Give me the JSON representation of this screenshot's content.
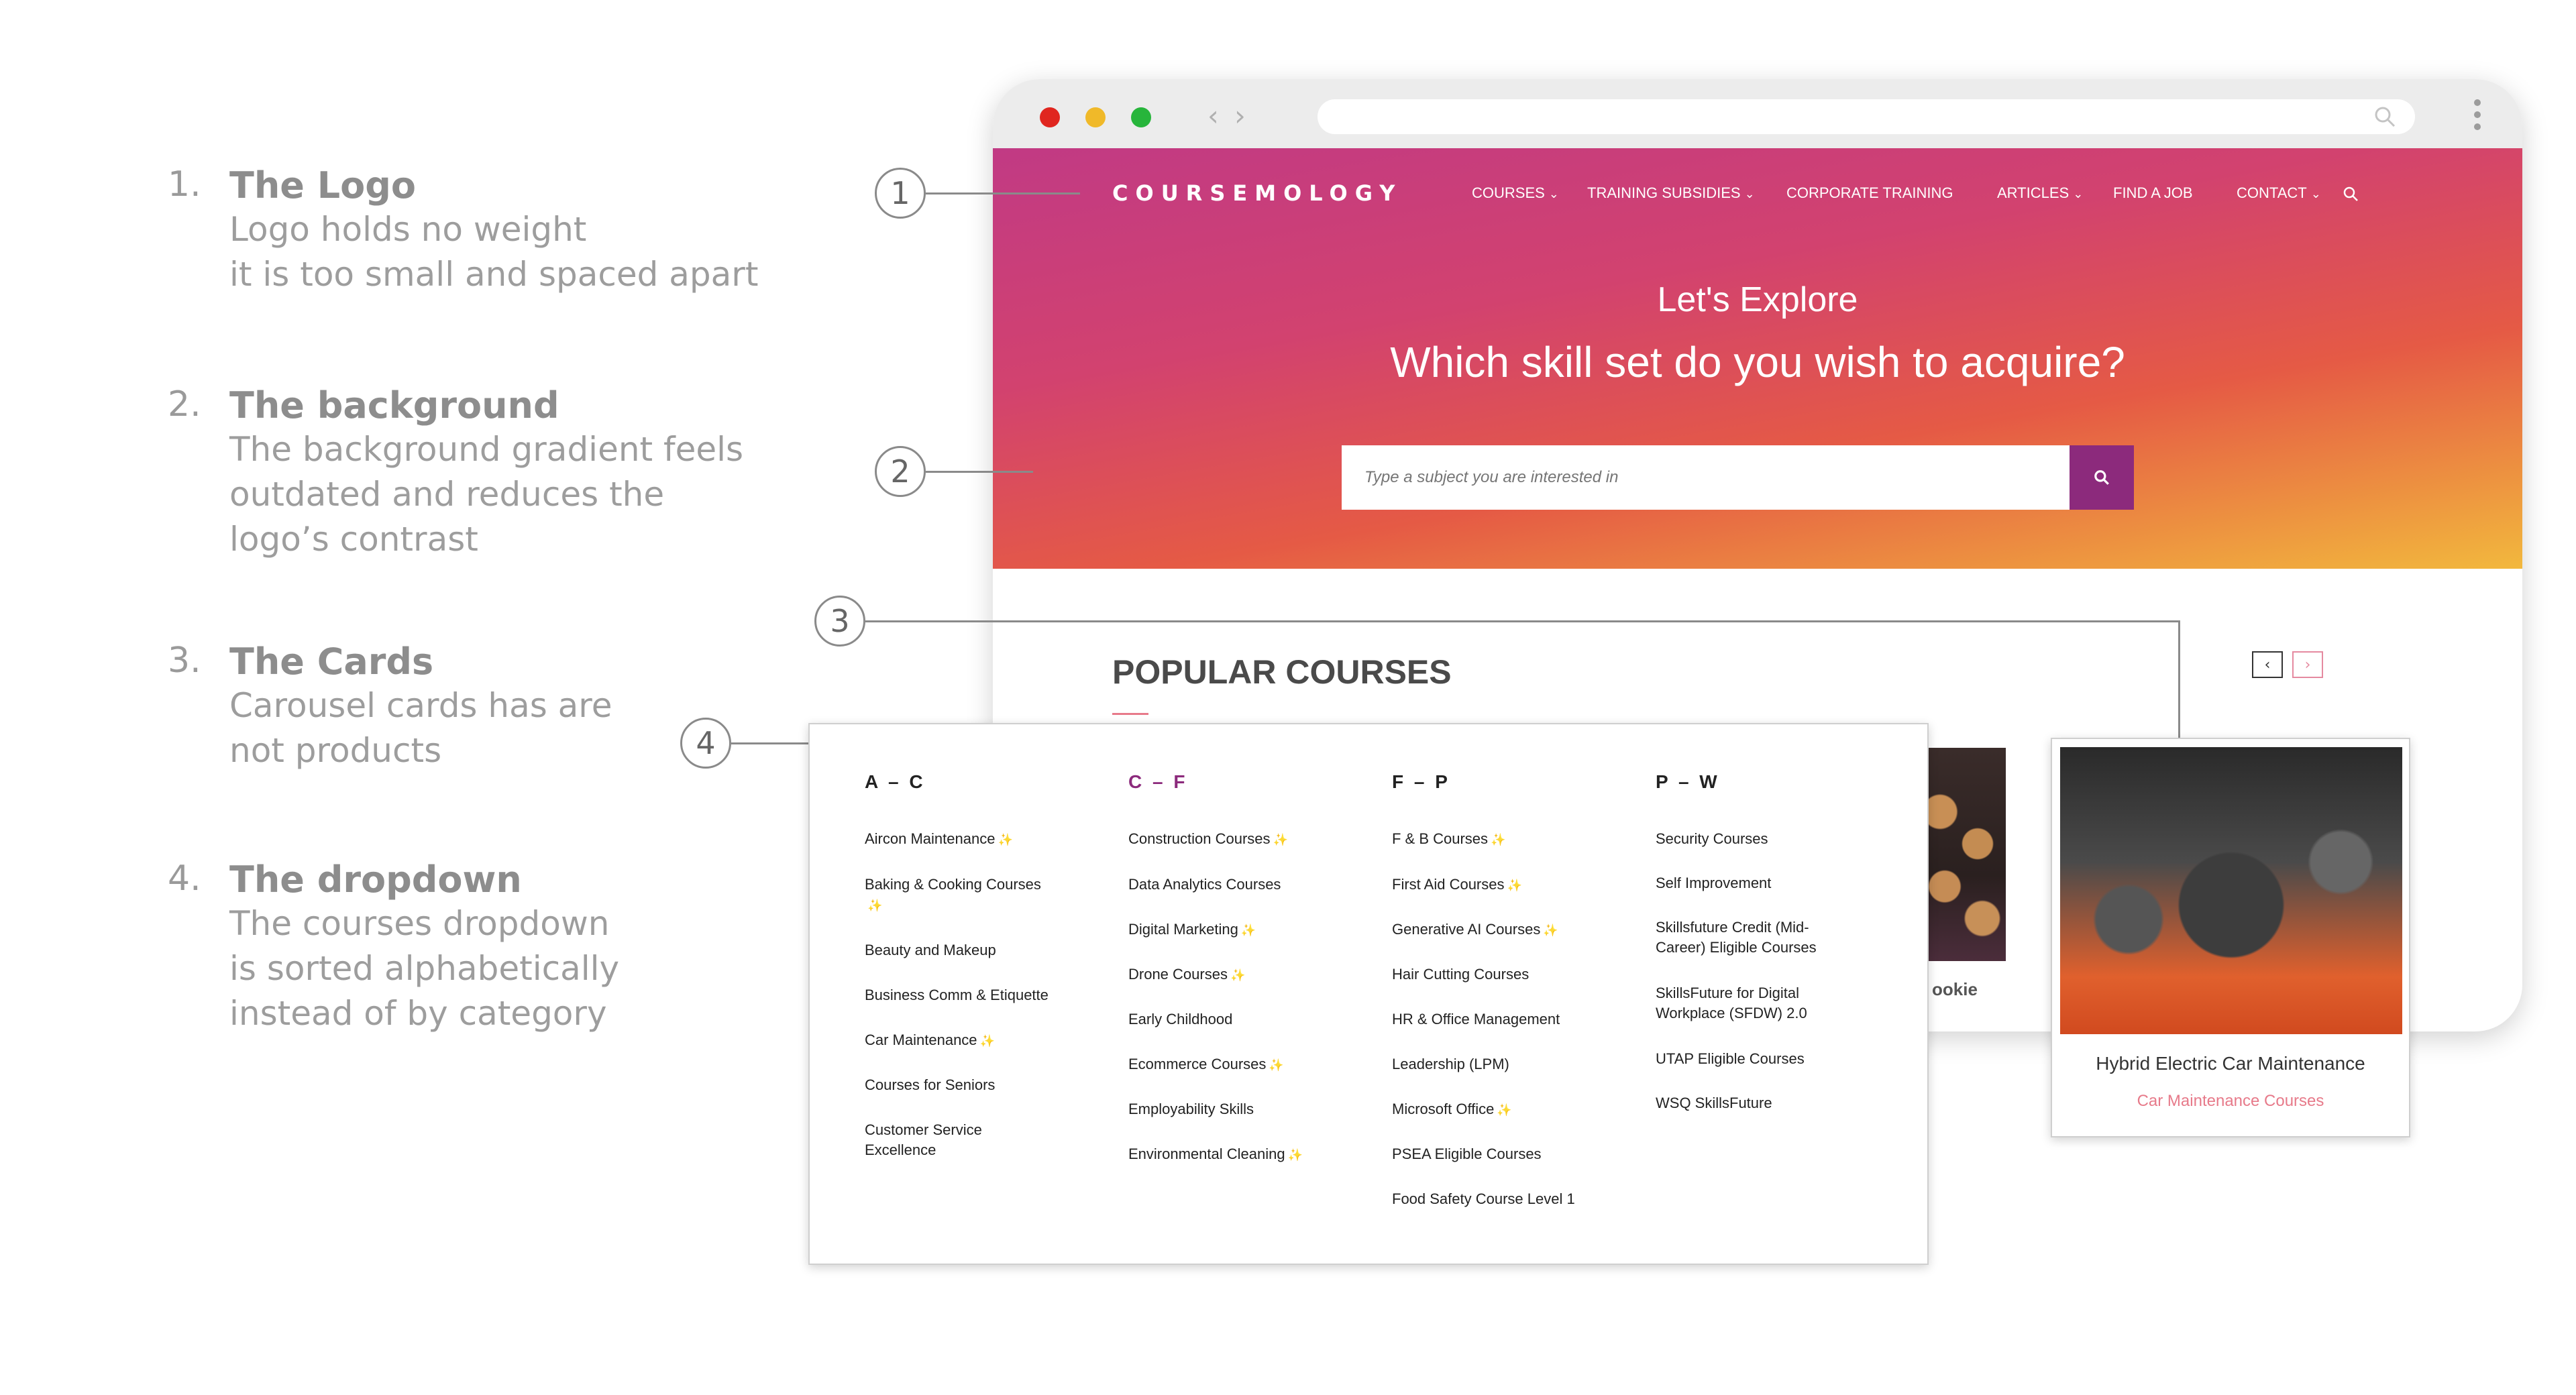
{
  "annotations": [
    {
      "num": "1.",
      "title": "The Logo",
      "lines": [
        "Logo holds no weight",
        "it is too small and spaced apart"
      ]
    },
    {
      "num": "2.",
      "title": "The background",
      "lines": [
        "The background gradient feels",
        "outdated and reduces the",
        "logo’s contrast"
      ]
    },
    {
      "num": "3.",
      "title": "The Cards",
      "lines": [
        "Carousel cards has are",
        "not products"
      ]
    },
    {
      "num": "4.",
      "title": "The dropdown",
      "lines": [
        "The courses dropdown",
        "is sorted alphabetically",
        "instead of by category"
      ]
    }
  ],
  "callouts": [
    "1",
    "2",
    "3",
    "4"
  ],
  "site": {
    "logo": "COURSEMOLOGY",
    "nav": [
      {
        "label": "COURSES",
        "dropdown": true
      },
      {
        "label": "TRAINING SUBSIDIES",
        "dropdown": true
      },
      {
        "label": "CORPORATE TRAINING",
        "dropdown": false
      },
      {
        "label": "ARTICLES",
        "dropdown": true
      },
      {
        "label": "FIND A JOB",
        "dropdown": false
      },
      {
        "label": "CONTACT",
        "dropdown": true
      }
    ],
    "hero_sub": "Let's Explore",
    "hero_title": "Which skill set do you wish to acquire?",
    "search_placeholder": "Type a subject you are interested in",
    "popular_title": "POPULAR COURSES",
    "carousel_prev": "‹",
    "carousel_next": "›",
    "cookie_label": "ookie"
  },
  "dropdown": {
    "columns": [
      {
        "head": "A – C",
        "items": [
          {
            "label": "Aircon Maintenance",
            "spark": true
          },
          {
            "label": "Baking & Cooking Courses",
            "spark": true
          },
          {
            "label": "Beauty and Makeup",
            "spark": false
          },
          {
            "label": "Business Comm & Etiquette",
            "spark": false
          },
          {
            "label": "Car Maintenance",
            "spark": true
          },
          {
            "label": "Courses for Seniors",
            "spark": false
          },
          {
            "label": "Customer Service Excellence",
            "spark": false
          }
        ]
      },
      {
        "head": "C – F",
        "items": [
          {
            "label": "Construction Courses",
            "spark": true
          },
          {
            "label": "Data Analytics Courses",
            "spark": false
          },
          {
            "label": "Digital Marketing",
            "spark": true
          },
          {
            "label": "Drone Courses",
            "spark": true
          },
          {
            "label": "Early Childhood",
            "spark": false
          },
          {
            "label": "Ecommerce Courses",
            "spark": true
          },
          {
            "label": "Employability Skills",
            "spark": false
          },
          {
            "label": "Environmental Cleaning",
            "spark": true
          }
        ]
      },
      {
        "head": "F – P",
        "items": [
          {
            "label": "F & B Courses",
            "spark": true
          },
          {
            "label": "First Aid Courses",
            "spark": true
          },
          {
            "label": "Generative AI Courses",
            "spark": true
          },
          {
            "label": "Hair Cutting Courses",
            "spark": false
          },
          {
            "label": "HR & Office Management",
            "spark": false
          },
          {
            "label": "Leadership (LPM)",
            "spark": false
          },
          {
            "label": "Microsoft Office",
            "spark": true
          },
          {
            "label": "PSEA Eligible Courses",
            "spark": false
          },
          {
            "label": "Food Safety Course Level 1",
            "spark": false
          }
        ]
      },
      {
        "head": "P – W",
        "items": [
          {
            "label": "Security Courses",
            "spark": false
          },
          {
            "label": "Self Improvement",
            "spark": false
          },
          {
            "label": "Skillsfuture Credit (Mid-Career) Eligible Courses",
            "spark": false
          },
          {
            "label": "SkillsFuture for Digital Workplace (SFDW) 2.0",
            "spark": false
          },
          {
            "label": "UTAP Eligible Courses",
            "spark": false
          },
          {
            "label": "WSQ SkillsFuture",
            "spark": false
          }
        ]
      }
    ]
  },
  "card": {
    "title": "Hybrid Electric Car Maintenance",
    "category": "Car Maintenance Courses"
  },
  "colors": {
    "accent_purple": "#8c2a7c",
    "link_pink": "#e77a8a",
    "spark_yellow": "#f1c232"
  }
}
